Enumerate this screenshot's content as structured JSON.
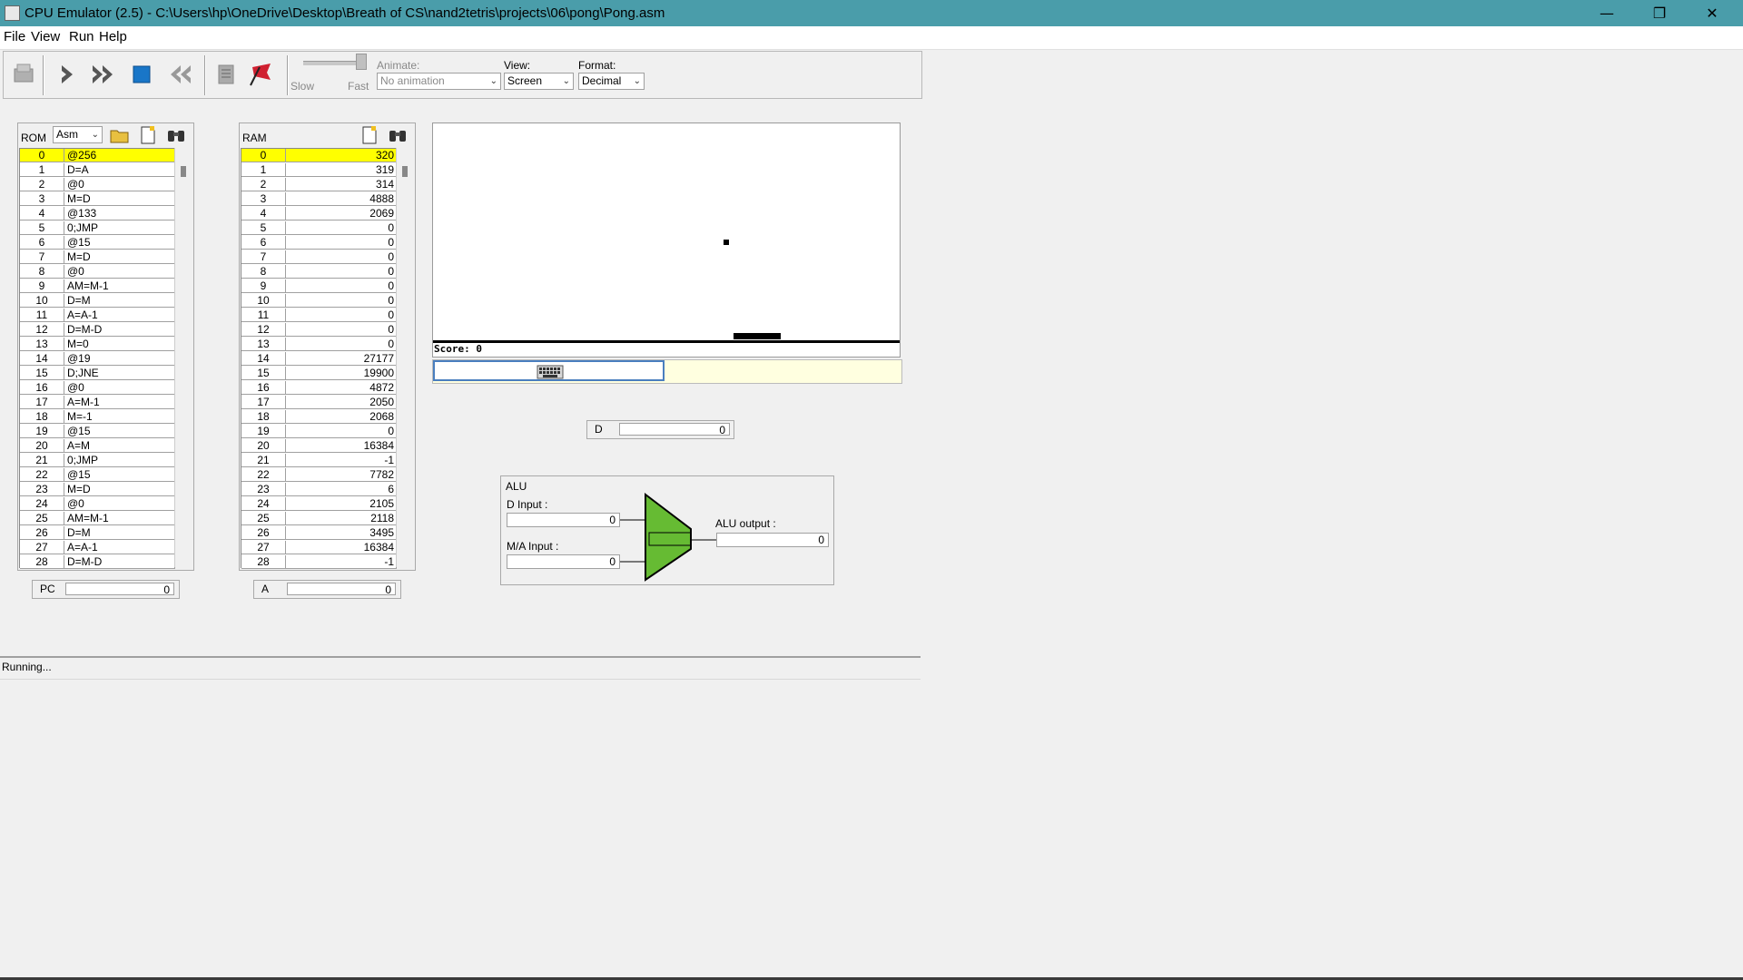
{
  "window": {
    "title": "CPU Emulator (2.5) - C:\\Users\\hp\\OneDrive\\Desktop\\Breath of CS\\nand2tetris\\projects\\06\\pong\\Pong.asm",
    "minimize": "—",
    "restore": "❐",
    "close": "✕"
  },
  "menu": [
    "File",
    "View",
    "Run",
    "Help"
  ],
  "toolbar": {
    "slow_label": "Slow",
    "fast_label": "Fast",
    "animate_label": "Animate:",
    "animate_value": "No animation",
    "view_label": "View:",
    "view_value": "Screen",
    "format_label": "Format:",
    "format_value": "Decimal",
    "speed_fraction": 1.0
  },
  "rom": {
    "label": "ROM",
    "mode": "Asm",
    "rows": [
      [
        "0",
        "@256"
      ],
      [
        "1",
        "D=A"
      ],
      [
        "2",
        "@0"
      ],
      [
        "3",
        "M=D"
      ],
      [
        "4",
        "@133"
      ],
      [
        "5",
        "0;JMP"
      ],
      [
        "6",
        "@15"
      ],
      [
        "7",
        "M=D"
      ],
      [
        "8",
        "@0"
      ],
      [
        "9",
        "AM=M-1"
      ],
      [
        "10",
        "D=M"
      ],
      [
        "11",
        "A=A-1"
      ],
      [
        "12",
        "D=M-D"
      ],
      [
        "13",
        "M=0"
      ],
      [
        "14",
        "@19"
      ],
      [
        "15",
        "D;JNE"
      ],
      [
        "16",
        "@0"
      ],
      [
        "17",
        "A=M-1"
      ],
      [
        "18",
        "M=-1"
      ],
      [
        "19",
        "@15"
      ],
      [
        "20",
        "A=M"
      ],
      [
        "21",
        "0;JMP"
      ],
      [
        "22",
        "@15"
      ],
      [
        "23",
        "M=D"
      ],
      [
        "24",
        "@0"
      ],
      [
        "25",
        "AM=M-1"
      ],
      [
        "26",
        "D=M"
      ],
      [
        "27",
        "A=A-1"
      ],
      [
        "28",
        "D=M-D"
      ]
    ]
  },
  "ram": {
    "label": "RAM",
    "rows": [
      [
        "0",
        "320"
      ],
      [
        "1",
        "319"
      ],
      [
        "2",
        "314"
      ],
      [
        "3",
        "4888"
      ],
      [
        "4",
        "2069"
      ],
      [
        "5",
        "0"
      ],
      [
        "6",
        "0"
      ],
      [
        "7",
        "0"
      ],
      [
        "8",
        "0"
      ],
      [
        "9",
        "0"
      ],
      [
        "10",
        "0"
      ],
      [
        "11",
        "0"
      ],
      [
        "12",
        "0"
      ],
      [
        "13",
        "0"
      ],
      [
        "14",
        "27177"
      ],
      [
        "15",
        "19900"
      ],
      [
        "16",
        "4872"
      ],
      [
        "17",
        "2050"
      ],
      [
        "18",
        "2068"
      ],
      [
        "19",
        "0"
      ],
      [
        "20",
        "16384"
      ],
      [
        "21",
        "-1"
      ],
      [
        "22",
        "7782"
      ],
      [
        "23",
        "6"
      ],
      [
        "24",
        "2105"
      ],
      [
        "25",
        "2118"
      ],
      [
        "26",
        "3495"
      ],
      [
        "27",
        "16384"
      ],
      [
        "28",
        "-1"
      ]
    ]
  },
  "registers": {
    "pc_label": "PC",
    "pc_value": "0",
    "a_label": "A",
    "a_value": "0",
    "d_label": "D",
    "d_value": "0"
  },
  "screen": {
    "score_text": "Score: 0"
  },
  "alu": {
    "title": "ALU",
    "d_input_label": "D Input :",
    "d_input_value": "0",
    "ma_input_label": "M/A Input :",
    "ma_input_value": "0",
    "output_label": "ALU output :",
    "output_value": "0",
    "color": "#66bb33"
  },
  "status": "Running...",
  "colors": {
    "titlebar": "#4a9daa",
    "selected_row": "#ffff00",
    "keyboard_bg": "#ffffe0"
  }
}
